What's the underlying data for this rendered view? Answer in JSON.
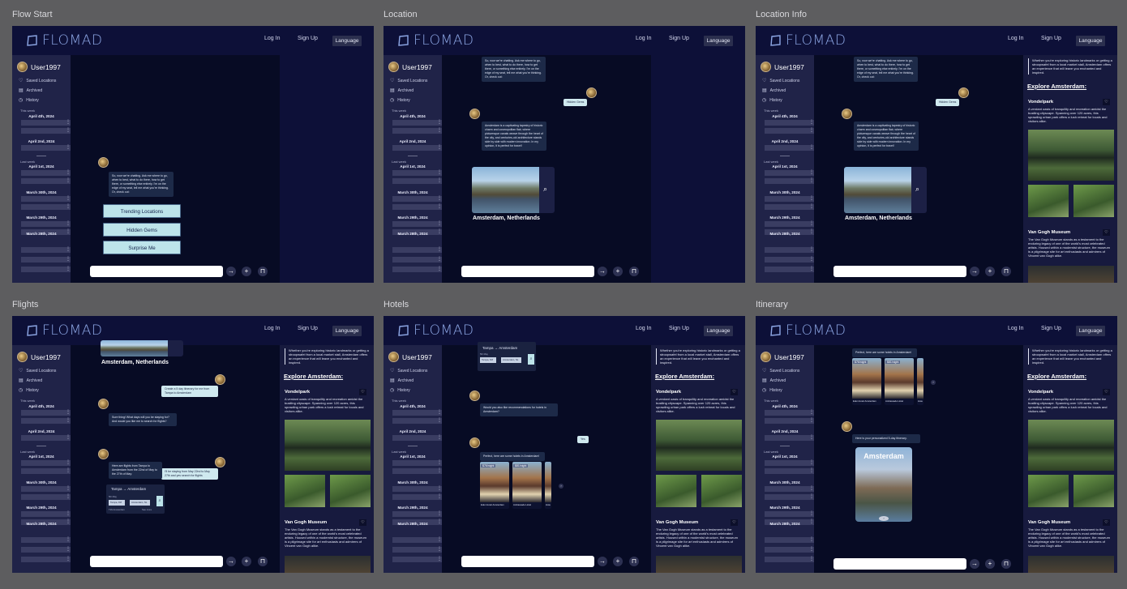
{
  "brand": {
    "name": "FLOMAD"
  },
  "header": {
    "login": "Log In",
    "signup": "Sign Up",
    "language": "Language"
  },
  "sidebar": {
    "user": "User1997",
    "items": [
      {
        "label": "Saved Locations",
        "icon": "heart-icon"
      },
      {
        "label": "Archived",
        "icon": "archive-icon"
      },
      {
        "label": "History",
        "icon": "history-icon"
      }
    ],
    "this_week": "This week",
    "last_week": "Last week",
    "dates": [
      "April 4th, 2024",
      "April 2nd, 2024",
      "April 1st, 2024",
      "March 30th, 2024",
      "March 29th, 2024",
      "March 28th, 2024"
    ]
  },
  "frames": {
    "flow_start": "Flow Start",
    "location": "Location",
    "location_info": "Location Info",
    "flights": "Flights",
    "hotels": "Hotels",
    "itinerary": "Itinerary"
  },
  "chat": {
    "intro": "So, now we're chatting. Ask me where to go, when to best, what to do there, how to get there, or something else entirely. I'm on the edge of my seat, tell me what you're thinking. Or, check out:",
    "options": [
      "Trending Locations",
      "Hidden Gems",
      "Surprise Me"
    ],
    "user_hidden_gems": "Hidden Gems",
    "amsterdam_desc": "Amsterdam is a captivating tapestry of historic charm and cosmopolitan flair, where picturesque canals weave through the heart of the city, and centuries-old architecture stands side by side with modern innovation. In my opinion, it is perfect for travel!",
    "location_title": "Amsterdam, Netherlands",
    "user_itinerary_req": "Create a 5 day itinerary for me from Tampa to Amsterdam",
    "bot_dates_q": "Sure thing! What days will you be staying for? And would you like me to search for flights?",
    "user_dates": "I'll be staying from May 22nd to May 27th and yes search for flights",
    "bot_flights": "Here are flights from Tampa to Amsterdam from the 22nd of May to the 27th of May:",
    "bot_hotels_q": "Would you also like recommendations for hotels in Amsterdam?",
    "user_yes": "Yes",
    "bot_hotels": "Perfect, here are some hotels in Amsterdam!",
    "bot_itinerary": "Here is your personalized 5-day itinerary.",
    "itinerary_title": "Amsterdam"
  },
  "flight_card": {
    "title": "Tampa → Amsterdam",
    "sub": "5th May",
    "from": "Tampa, FM",
    "to": "Amsterdam, NL",
    "footer_left": "T29 Amsterdam",
    "footer_right": "See more"
  },
  "hotels": [
    {
      "price": "$76/night",
      "name": "Eden Hotel Amsterdam"
    },
    {
      "price": "$81/night",
      "name": "Ambassade Hotel"
    },
    {
      "price": "",
      "name": "Hote"
    }
  ],
  "info": {
    "quote": "Whether you're exploring historic landmarks or getting a stroopwafel from a local market stall, Amsterdam offers an experience that will leave you enchanted and inspired.",
    "explore": "Explore Amsterdam:",
    "places": [
      {
        "name": "Vondelpark",
        "desc": "A verdant oasis of tranquility and recreation amidst the bustling cityscape. Spanning over 120 acres, this sprawling urban park offers a lush retreat for locals and visitors alike."
      },
      {
        "name": "Van Gogh Museum",
        "desc": "The Van Gogh Museum stands as a testament to the enduring legacy of one of the world's most celebrated artists. Housed within a modernist structure, the museum is a pilgrimage site for art enthusiasts and admirers of Vincent van Gogh alike."
      }
    ]
  },
  "colors": {
    "header": "#0d1038",
    "sidebar": "#202348",
    "chat": "#070b24",
    "accent": "#bde4ea"
  }
}
